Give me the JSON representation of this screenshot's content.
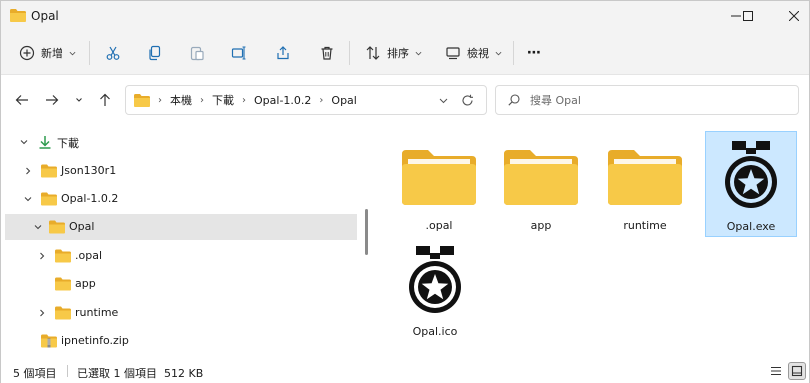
{
  "window": {
    "title": "Opal"
  },
  "toolbar": {
    "new_label": "新增",
    "sort_label": "排序",
    "view_label": "檢視",
    "more_label": "⋯"
  },
  "address": {
    "crumbs": [
      "本機",
      "下載",
      "Opal-1.0.2",
      "Opal"
    ]
  },
  "search": {
    "placeholder": "搜尋 Opal"
  },
  "nav_tree": [
    {
      "label": "下載",
      "icon": "download-icon"
    },
    {
      "label": "Json130r1",
      "icon": "folder-icon"
    },
    {
      "label": "Opal-1.0.2",
      "icon": "folder-icon"
    },
    {
      "label": "Opal",
      "icon": "folder-icon",
      "selected": true
    },
    {
      "label": ".opal",
      "icon": "folder-icon"
    },
    {
      "label": "app",
      "icon": "folder-icon"
    },
    {
      "label": "runtime",
      "icon": "folder-icon"
    },
    {
      "label": "ipnetinfo.zip",
      "icon": "zip-icon"
    }
  ],
  "files": [
    {
      "name": ".opal",
      "type": "folder"
    },
    {
      "name": "app",
      "type": "folder"
    },
    {
      "name": "runtime",
      "type": "folder"
    },
    {
      "name": "Opal.exe",
      "type": "medal",
      "selected": true
    },
    {
      "name": "Opal.ico",
      "type": "medal"
    }
  ],
  "status": {
    "count": "5 個項目",
    "selection": "已選取 1 個項目  512 KB"
  },
  "colors": {
    "folder": "#f7c948",
    "folder_dark": "#e8ac2a",
    "selection": "#cce8ff",
    "accent_green": "#2e9b4f"
  }
}
